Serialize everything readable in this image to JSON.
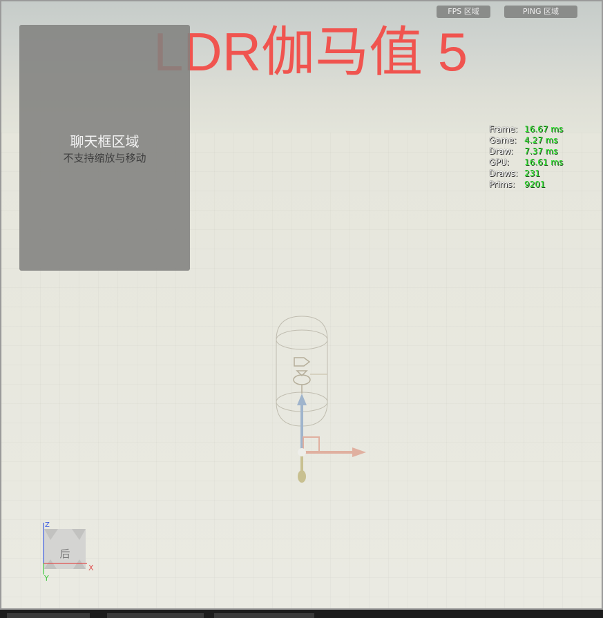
{
  "topbar": {
    "fps_label": "FPS 区域",
    "ping_label": "PING 区域"
  },
  "overlay": {
    "title": "LDR伽马值 5"
  },
  "chat": {
    "title": "聊天框区域",
    "subtitle": "不支持缩放与移动"
  },
  "stats": [
    {
      "label": "Frame:",
      "value": "16.67 ms"
    },
    {
      "label": "Game:",
      "value": "4.27 ms"
    },
    {
      "label": "Draw:",
      "value": "7.37 ms"
    },
    {
      "label": "GPU:",
      "value": "16.61 ms"
    },
    {
      "label": "Draws:",
      "value": "231"
    },
    {
      "label": "Prims:",
      "value": "9201"
    }
  ],
  "axis_widget": {
    "face_label": "后",
    "z_label": "Z",
    "x_label": "X",
    "y_label": "Y"
  },
  "colors": {
    "title": "#f0544f",
    "stat_value": "#2ee32e",
    "axis_x": "#e05050",
    "axis_y": "#3cc83c",
    "axis_z": "#3a5ae0"
  }
}
